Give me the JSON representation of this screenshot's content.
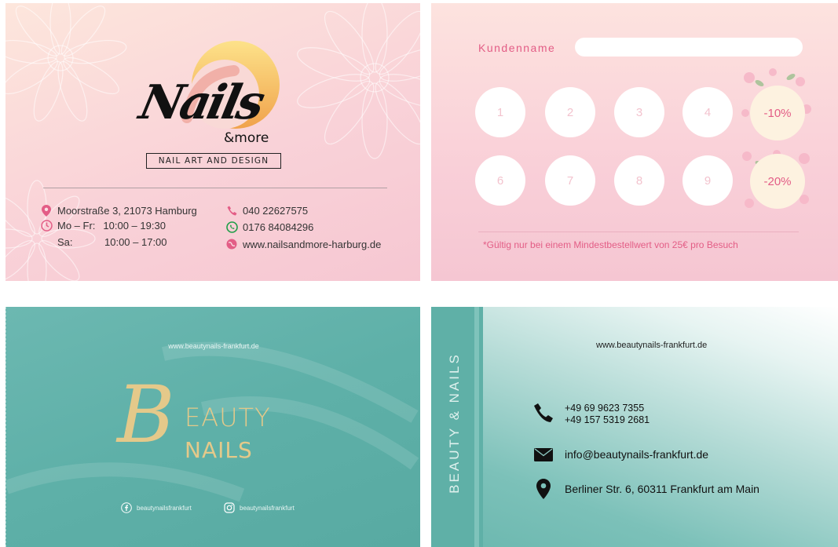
{
  "card1": {
    "logo_script": "Nails",
    "logo_sub": "&more",
    "tagline": "NAIL ART AND DESIGN",
    "address": "Moorstraße 3, 21073 Hamburg",
    "hours_weekday_label": "Mo – Fr:",
    "hours_weekday": "10:00 – 19:30",
    "hours_sat_label": "Sa:",
    "hours_sat": "10:00 – 17:00",
    "phone": "040 22627575",
    "whatsapp": "0176 84084296",
    "website": "www.nailsandmore-harburg.de",
    "accent_color": "#e35d86"
  },
  "card2": {
    "name_label": "Kundenname",
    "stamps_row1": [
      "1",
      "2",
      "3",
      "4"
    ],
    "stamps_row2": [
      "6",
      "7",
      "8",
      "9"
    ],
    "bonus1": "-10%",
    "bonus2": "-20%",
    "note": "*Gültig nur bei einem Mindestbestellwert von 25€ pro Besuch"
  },
  "card3": {
    "website": "www.beautynails-frankfurt.de",
    "logo_b": "B",
    "logo_eauty": "EAUTY",
    "logo_nails": "NAILS",
    "facebook": "beautynailsfrankfurt",
    "instagram": "beautynailsfrankfurt",
    "gold_color": "#e4c98a"
  },
  "card4": {
    "side_text": "BEAUTY & NAILS",
    "website": "www.beautynails-frankfurt.de",
    "phone1": "+49 69 9623 7355",
    "phone2": "+49 157 5319 2681",
    "email": "info@beautynails-frankfurt.de",
    "address": "Berliner Str. 6, 60311 Frankfurt am Main",
    "teal_color": "#5fb0a7"
  }
}
